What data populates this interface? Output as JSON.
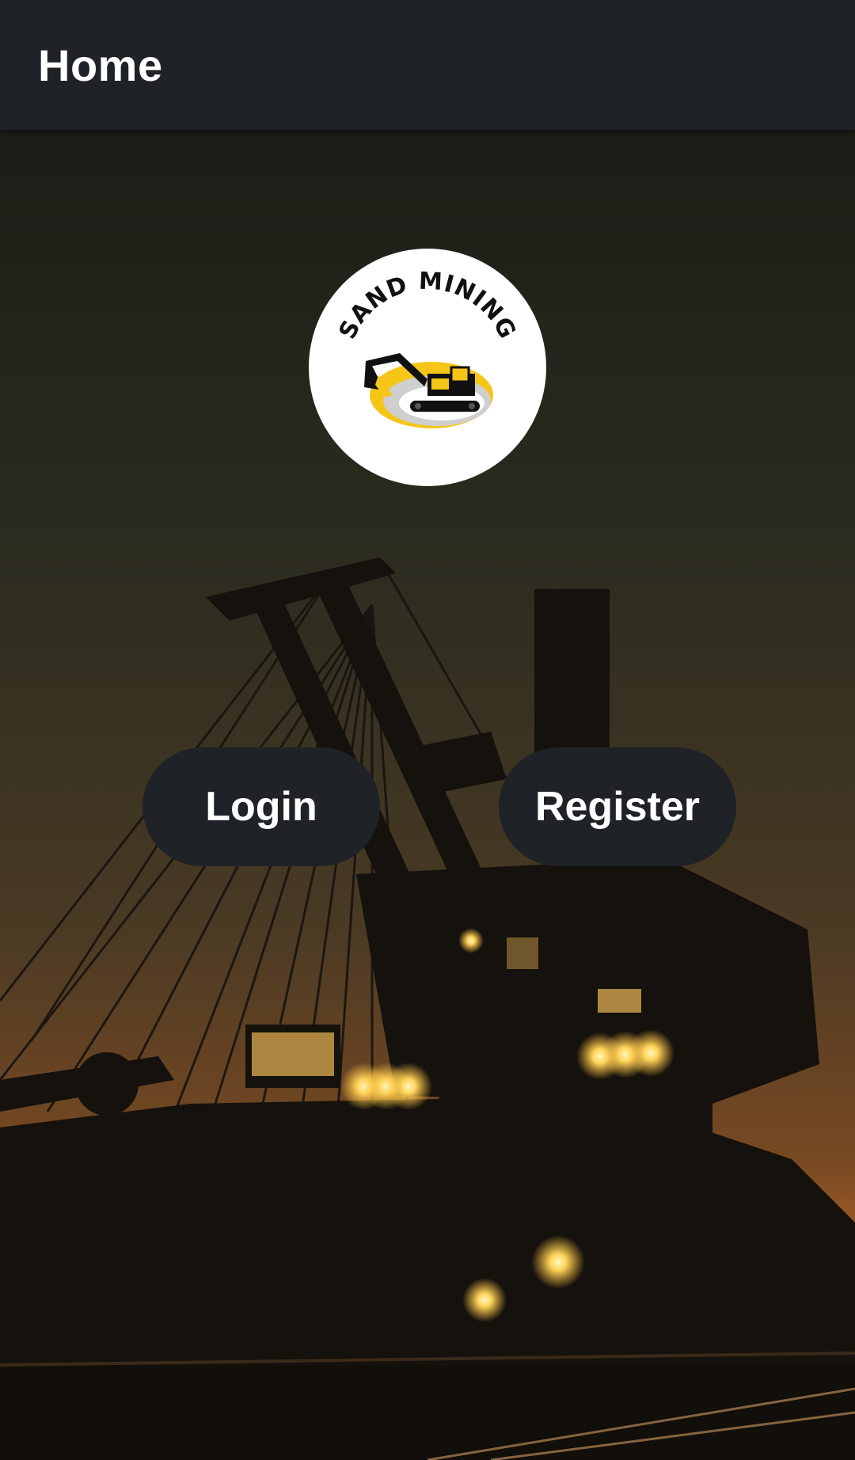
{
  "appbar": {
    "title": "Home"
  },
  "logo": {
    "text": "SAND MINING",
    "icon": "excavator-icon",
    "colors": {
      "accent": "#f5c518",
      "ink": "#111111"
    }
  },
  "actions": {
    "login_label": "Login",
    "register_label": "Register"
  },
  "background": {
    "description_icon": "mining-excavator-night-photo"
  },
  "colors": {
    "appbar": "#1f2227",
    "button": "#1f2227",
    "button_text": "#ffffff"
  }
}
